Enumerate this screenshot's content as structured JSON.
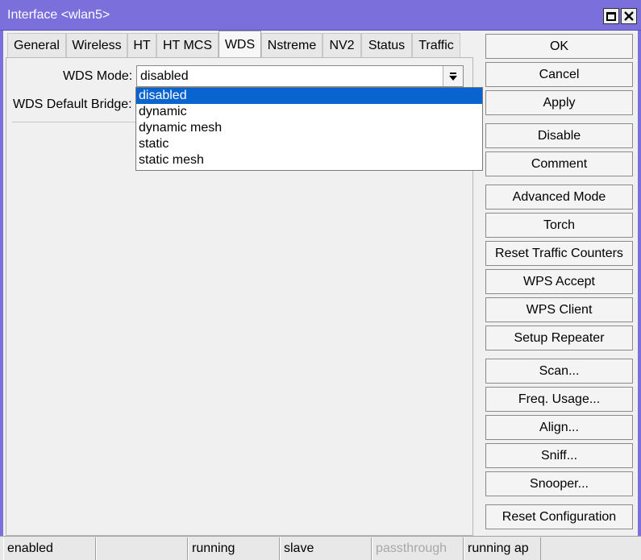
{
  "window": {
    "title": "Interface <wlan5>",
    "maximize_icon": "maximize-icon",
    "close_icon": "close-icon",
    "accent_color": "#7b6fdc"
  },
  "tabs": [
    {
      "label": "General"
    },
    {
      "label": "Wireless"
    },
    {
      "label": "HT"
    },
    {
      "label": "HT MCS"
    },
    {
      "label": "WDS",
      "active": true
    },
    {
      "label": "Nstreme"
    },
    {
      "label": "NV2"
    },
    {
      "label": "Status"
    },
    {
      "label": "Traffic"
    }
  ],
  "form": {
    "wds_mode_label": "WDS Mode:",
    "wds_mode_value": "disabled",
    "wds_default_bridge_label": "WDS Default Bridge:"
  },
  "dropdown": {
    "options": [
      "disabled",
      "dynamic",
      "dynamic mesh",
      "static",
      "static mesh"
    ],
    "selected": "disabled",
    "highlight_color": "#0a64d0"
  },
  "buttons": {
    "ok": "OK",
    "cancel": "Cancel",
    "apply": "Apply",
    "disable": "Disable",
    "comment": "Comment",
    "advanced_mode": "Advanced Mode",
    "torch": "Torch",
    "reset_traffic_counters": "Reset Traffic Counters",
    "wps_accept": "WPS Accept",
    "wps_client": "WPS Client",
    "setup_repeater": "Setup Repeater",
    "scan": "Scan...",
    "freq_usage": "Freq. Usage...",
    "align": "Align...",
    "sniff": "Sniff...",
    "snooper": "Snooper...",
    "reset_configuration": "Reset Configuration"
  },
  "status": {
    "state": "enabled",
    "empty": "",
    "running": "running",
    "slave": "slave",
    "passthrough": "passthrough",
    "running_ap": "running ap"
  }
}
